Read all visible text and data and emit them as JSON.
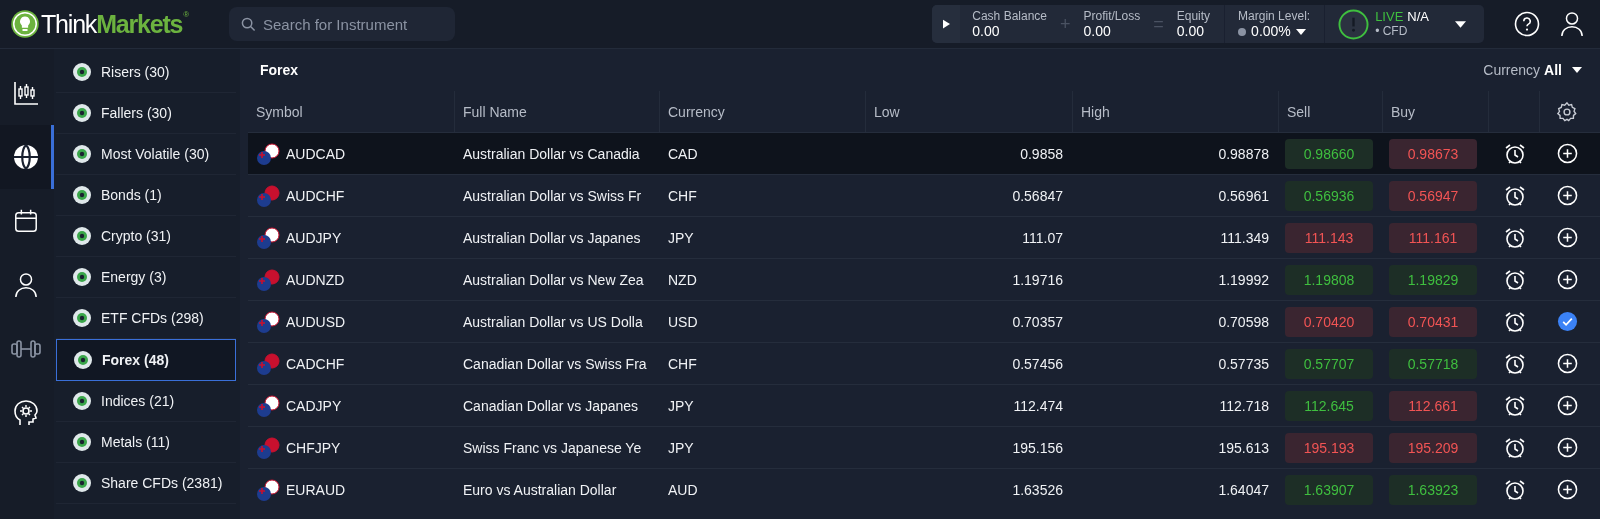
{
  "logo": {
    "primary": "Think",
    "accent": "Markets",
    "mark": "®"
  },
  "search": {
    "placeholder": "Search for Instrument"
  },
  "account": {
    "fields": [
      {
        "label": "Cash Balance",
        "value": "0.00"
      },
      {
        "label": "Profit/Loss",
        "value": "0.00"
      },
      {
        "label": "Equity",
        "value": "0.00"
      }
    ],
    "operators": [
      "+",
      "="
    ],
    "margin": {
      "label": "Margin Level:",
      "value": "0.00%"
    },
    "mode": "LIVE",
    "status": "N/A",
    "type": "• CFD"
  },
  "rail": [
    {
      "kind": "chart",
      "selected": false
    },
    {
      "kind": "globe",
      "selected": true
    },
    {
      "kind": "calendar",
      "selected": false
    },
    {
      "kind": "person",
      "selected": false
    },
    {
      "kind": "dumbbell",
      "selected": false
    },
    {
      "kind": "head",
      "selected": false
    }
  ],
  "categories": [
    {
      "label": "Risers (30)",
      "selected": false
    },
    {
      "label": "Fallers (30)",
      "selected": false
    },
    {
      "label": "Most Volatile (30)",
      "selected": false
    },
    {
      "label": "Bonds (1)",
      "selected": false
    },
    {
      "label": "Crypto (31)",
      "selected": false
    },
    {
      "label": "Energy (3)",
      "selected": false
    },
    {
      "label": "ETF CFDs (298)",
      "selected": false
    },
    {
      "label": "Forex (48)",
      "selected": true
    },
    {
      "label": "Indices (21)",
      "selected": false
    },
    {
      "label": "Metals (11)",
      "selected": false
    },
    {
      "label": "Share CFDs (2381)",
      "selected": false
    }
  ],
  "panel": {
    "title": "Forex",
    "filter_label": "Currency",
    "filter_value": "All"
  },
  "table": {
    "columns": [
      "Symbol",
      "Full Name",
      "Currency",
      "Low",
      "High",
      "Sell",
      "Buy"
    ],
    "rows": [
      {
        "symbol": "AUDCAD",
        "name": "Australian Dollar vs Canadia",
        "currency": "CAD",
        "low": "0.9858",
        "high": "0.98878",
        "sell": "0.98660",
        "sell_up": true,
        "buy": "0.98673",
        "buy_up": false,
        "selected": true,
        "added": false
      },
      {
        "symbol": "AUDCHF",
        "name": "Australian Dollar vs Swiss Fr",
        "currency": "CHF",
        "low": "0.56847",
        "high": "0.56961",
        "sell": "0.56936",
        "sell_up": true,
        "buy": "0.56947",
        "buy_up": false,
        "selected": false,
        "added": false
      },
      {
        "symbol": "AUDJPY",
        "name": "Australian Dollar vs Japanes",
        "currency": "JPY",
        "low": "111.07",
        "high": "111.349",
        "sell": "111.143",
        "sell_up": false,
        "buy": "111.161",
        "buy_up": false,
        "selected": false,
        "added": false
      },
      {
        "symbol": "AUDNZD",
        "name": "Australian Dollar vs New Zea",
        "currency": "NZD",
        "low": "1.19716",
        "high": "1.19992",
        "sell": "1.19808",
        "sell_up": true,
        "buy": "1.19829",
        "buy_up": true,
        "selected": false,
        "added": false
      },
      {
        "symbol": "AUDUSD",
        "name": "Australian Dollar vs US Dolla",
        "currency": "USD",
        "low": "0.70357",
        "high": "0.70598",
        "sell": "0.70420",
        "sell_up": false,
        "buy": "0.70431",
        "buy_up": false,
        "selected": false,
        "added": true
      },
      {
        "symbol": "CADCHF",
        "name": "Canadian Dollar vs Swiss Fra",
        "currency": "CHF",
        "low": "0.57456",
        "high": "0.57735",
        "sell": "0.57707",
        "sell_up": true,
        "buy": "0.57718",
        "buy_up": true,
        "selected": false,
        "added": false
      },
      {
        "symbol": "CADJPY",
        "name": "Canadian Dollar vs Japanes",
        "currency": "JPY",
        "low": "112.474",
        "high": "112.718",
        "sell": "112.645",
        "sell_up": true,
        "buy": "112.661",
        "buy_up": false,
        "selected": false,
        "added": false
      },
      {
        "symbol": "CHFJPY",
        "name": "Swiss Franc vs Japanese Ye",
        "currency": "JPY",
        "low": "195.156",
        "high": "195.613",
        "sell": "195.193",
        "sell_up": false,
        "buy": "195.209",
        "buy_up": false,
        "selected": false,
        "added": false
      },
      {
        "symbol": "EURAUD",
        "name": "Euro vs Australian Dollar",
        "currency": "AUD",
        "low": "1.63526",
        "high": "1.64047",
        "sell": "1.63907",
        "sell_up": true,
        "buy": "1.63923",
        "buy_up": true,
        "selected": false,
        "added": false
      }
    ]
  }
}
